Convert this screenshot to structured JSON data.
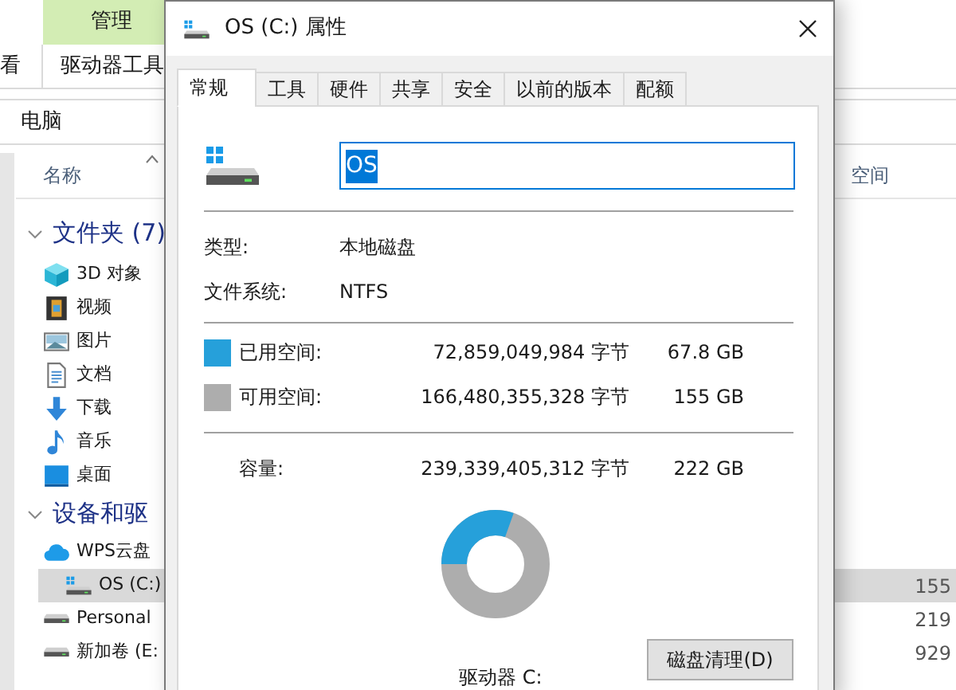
{
  "explorer": {
    "context_tab": {
      "label": "管理"
    },
    "ribbon_tabs": [
      {
        "label": "看",
        "selected": false
      },
      {
        "label": "驱动器工具",
        "selected": false
      }
    ],
    "address": "电脑",
    "columns": [
      {
        "label": "名称"
      },
      {
        "label": "空间"
      }
    ],
    "groups": [
      {
        "label": "文件夹 (7)",
        "expanded": true,
        "items": [
          {
            "label": "3D 对象",
            "kind": "cube",
            "selected": false
          },
          {
            "label": "视频",
            "kind": "video",
            "selected": false
          },
          {
            "label": "图片",
            "kind": "picture",
            "selected": false
          },
          {
            "label": "文档",
            "kind": "document",
            "selected": false
          },
          {
            "label": "下载",
            "kind": "download",
            "selected": false
          },
          {
            "label": "音乐",
            "kind": "music",
            "selected": false
          },
          {
            "label": "桌面",
            "kind": "desktop",
            "selected": false
          }
        ]
      },
      {
        "label": "设备和驱",
        "expanded": true,
        "items": [
          {
            "label": "WPS云盘",
            "kind": "cloud",
            "selected": false
          },
          {
            "label": "OS (C:)",
            "kind": "windrive",
            "selected": true,
            "size": "155"
          },
          {
            "label": "Personal",
            "kind": "drive",
            "selected": false,
            "size": "219"
          },
          {
            "label": "新加卷 (E:",
            "kind": "drive",
            "selected": false,
            "size": "929"
          }
        ]
      }
    ]
  },
  "dialog": {
    "title": "OS (C:) 属性",
    "tabs": [
      {
        "label": "常规",
        "selected": true
      },
      {
        "label": "工具",
        "selected": false
      },
      {
        "label": "硬件",
        "selected": false
      },
      {
        "label": "共享",
        "selected": false
      },
      {
        "label": "安全",
        "selected": false
      },
      {
        "label": "以前的版本",
        "selected": false
      },
      {
        "label": "配额",
        "selected": false
      }
    ],
    "name_field": {
      "value": "OS",
      "value_selected": true
    },
    "properties": [
      {
        "label": "类型:",
        "value": "本地磁盘"
      },
      {
        "label": "文件系统:",
        "value": "NTFS"
      }
    ],
    "space": [
      {
        "label": "已用空间:",
        "bytes": "72,859,049,984 字节",
        "size": "67.8 GB",
        "color": "#26a0da"
      },
      {
        "label": "可用空间:",
        "bytes": "166,480,355,328 字节",
        "size": "155 GB",
        "color": "#adadad"
      }
    ],
    "capacity": {
      "label": "容量:",
      "bytes": "239,339,405,312 字节",
      "size": "222 GB"
    },
    "usage": {
      "level": 0.304
    },
    "drive_label": "驱动器 C:",
    "button": "磁盘清理(D)"
  }
}
